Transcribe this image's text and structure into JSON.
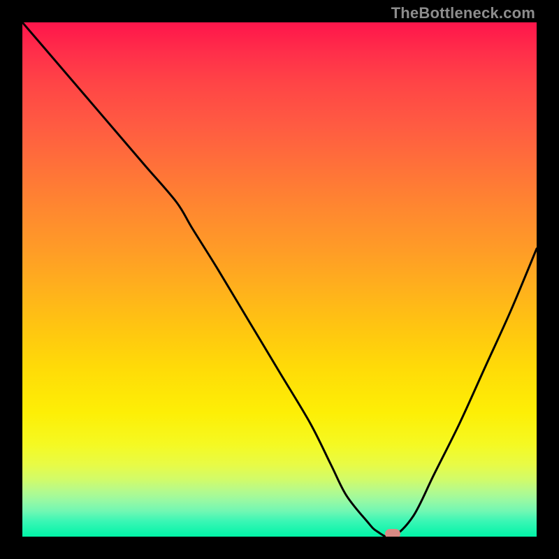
{
  "watermark": "TheBottleneck.com",
  "chart_data": {
    "type": "line",
    "title": "",
    "xlabel": "",
    "ylabel": "",
    "xlim": [
      0,
      100
    ],
    "ylim": [
      0,
      100
    ],
    "series": [
      {
        "name": "curve",
        "x": [
          0,
          6,
          12,
          18,
          24,
          30,
          33,
          38,
          44,
          50,
          56,
          60,
          63,
          67,
          69,
          72,
          76,
          80,
          85,
          90,
          95,
          100
        ],
        "y": [
          100,
          93,
          86,
          79,
          72,
          65,
          60,
          52,
          42,
          32,
          22,
          14,
          8,
          3,
          1,
          0,
          4,
          12,
          22,
          33,
          44,
          56
        ]
      }
    ],
    "marker": {
      "x": 72,
      "y": 0.5
    },
    "gradient_stops": [
      {
        "pct": 0,
        "color": "#ff154b"
      },
      {
        "pct": 12,
        "color": "#ff4546"
      },
      {
        "pct": 28,
        "color": "#ff7139"
      },
      {
        "pct": 44,
        "color": "#ff9b27"
      },
      {
        "pct": 60,
        "color": "#ffc710"
      },
      {
        "pct": 76,
        "color": "#fdef06"
      },
      {
        "pct": 88,
        "color": "#d0fb6b"
      },
      {
        "pct": 100,
        "color": "#00f4a7"
      }
    ]
  }
}
